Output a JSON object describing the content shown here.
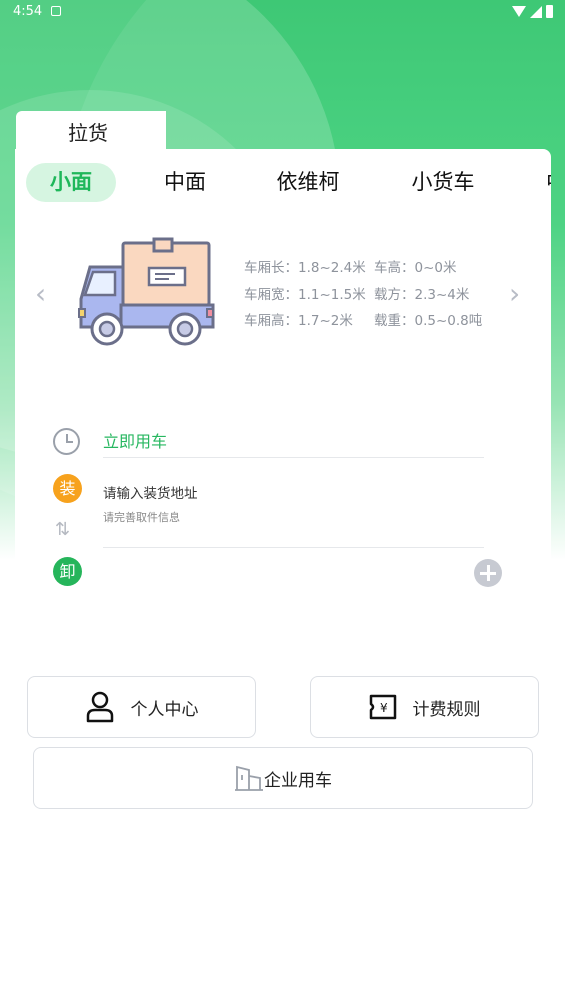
{
  "status_bar": {
    "time": "4:54"
  },
  "tab": {
    "label": "拉货"
  },
  "vehicle_types": [
    "小面",
    "中面",
    "依维柯",
    "小货车",
    "中"
  ],
  "active_type_index": 0,
  "specs": {
    "length": "车厢长：1.8~2.4米",
    "height": "车高：0~0米",
    "width": "车厢宽：1.1~1.5米",
    "volume": "载方：2.3~4米",
    "box_height": "车厢高：1.7~2米",
    "load": "载重：0.5~0.8吨"
  },
  "form": {
    "time_label": "立即用车",
    "load_badge": "装",
    "unload_badge": "卸",
    "load_address_placeholder": "请输入装货地址",
    "load_address_hint": "请完善取件信息"
  },
  "buttons": {
    "profile": "个人中心",
    "pricing": "计费规则",
    "enterprise": "企业用车"
  },
  "icons": {
    "prev": "chevron-left-icon",
    "next": "chevron-right-icon",
    "clock": "clock-icon",
    "swap": "swap-icon",
    "add": "plus-circle-icon",
    "person": "person-icon",
    "price": "price-tag-icon",
    "building": "building-icon"
  },
  "colors": {
    "accent": "#27b760",
    "load": "#f7a21d"
  }
}
